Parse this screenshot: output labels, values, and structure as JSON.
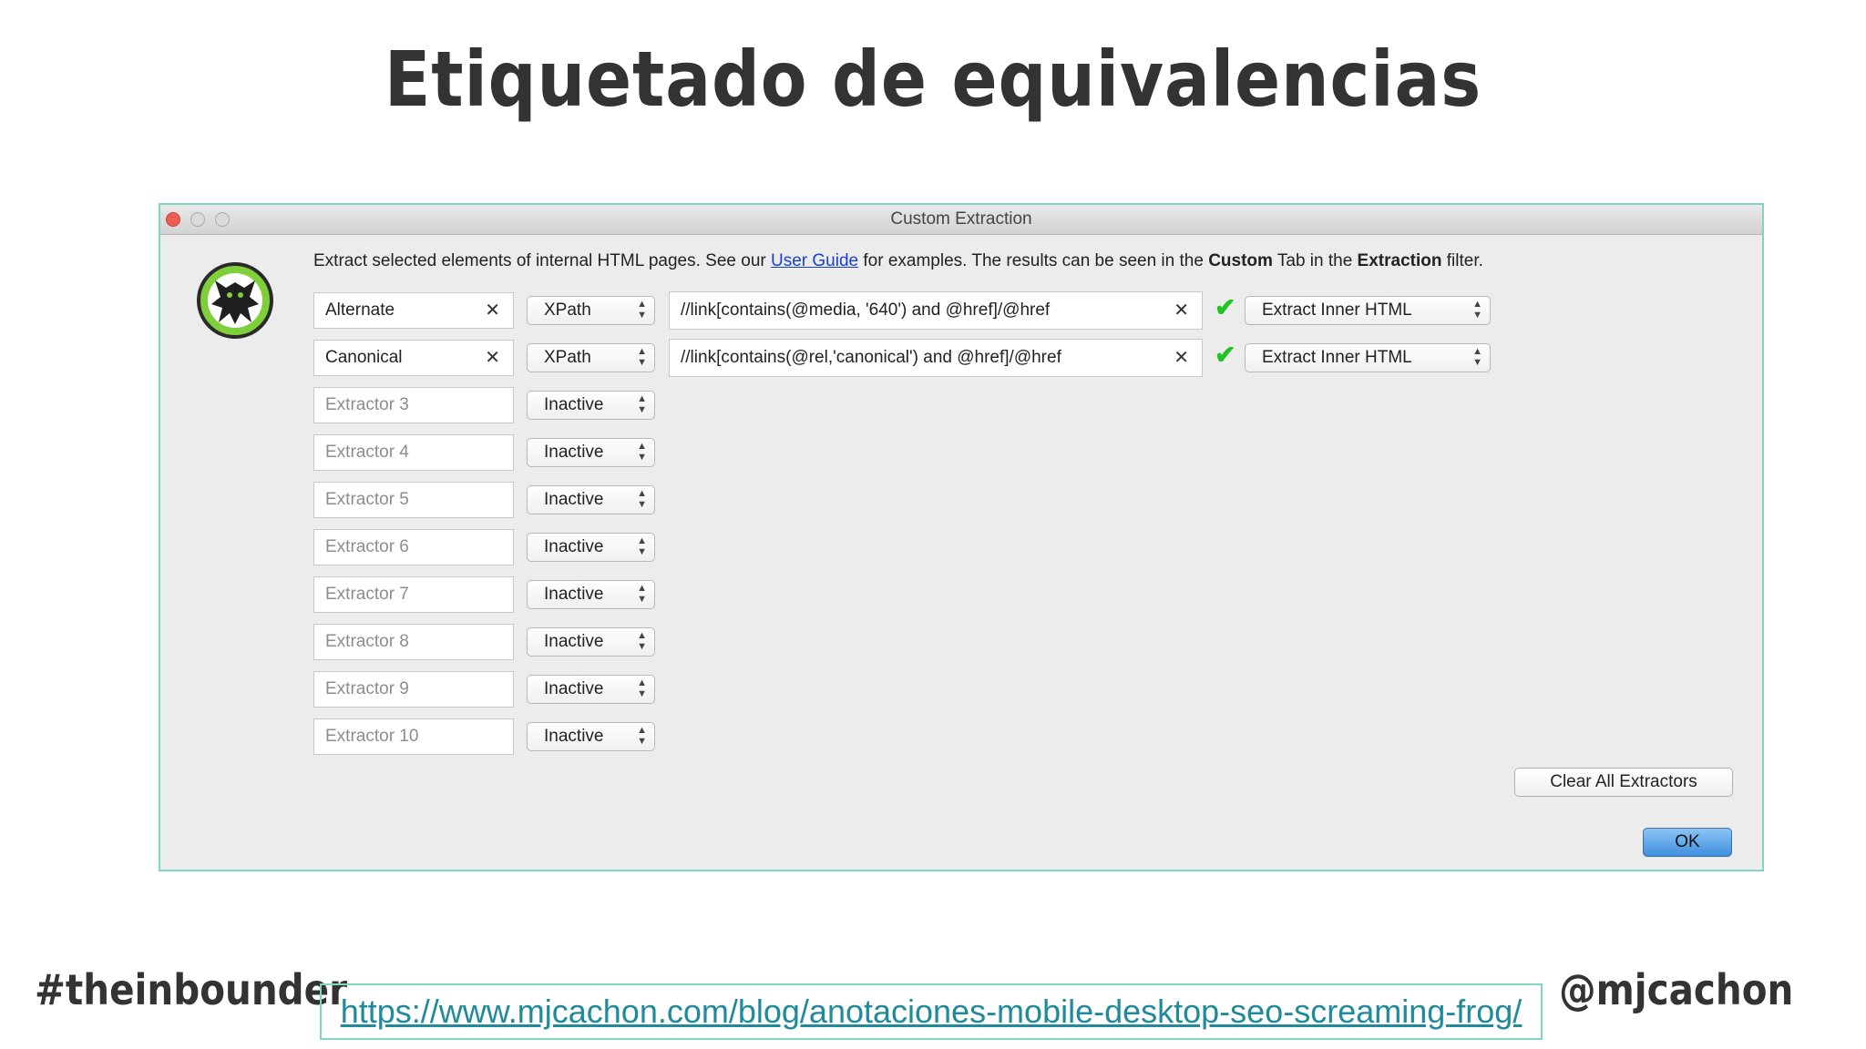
{
  "slide": {
    "title": "Etiquetado de equivalencias",
    "hashtag": "#theinbounder",
    "handle": "@mjcachon",
    "url": "https://www.mjcachon.com/blog/anotaciones-mobile-desktop-seo-screaming-frog/"
  },
  "window": {
    "title": "Custom Extraction",
    "intro": {
      "text1": "Extract selected elements of internal HTML pages. See our ",
      "link": "User Guide",
      "text2": " for examples. The results can be seen in the ",
      "bold1": "Custom",
      "text3": " Tab in the ",
      "bold2": "Extraction",
      "text4": " filter."
    },
    "extractors": [
      {
        "name": "Alternate",
        "type": "XPath",
        "expression": "//link[contains(@media, '640') and @href]/@href",
        "mode": "Extract Inner HTML"
      },
      {
        "name": "Canonical",
        "type": "XPath",
        "expression": "//link[contains(@rel,'canonical') and @href]/@href",
        "mode": "Extract Inner HTML"
      },
      {
        "name": "Extractor 3",
        "type": "Inactive"
      },
      {
        "name": "Extractor 4",
        "type": "Inactive"
      },
      {
        "name": "Extractor 5",
        "type": "Inactive"
      },
      {
        "name": "Extractor 6",
        "type": "Inactive"
      },
      {
        "name": "Extractor 7",
        "type": "Inactive"
      },
      {
        "name": "Extractor 8",
        "type": "Inactive"
      },
      {
        "name": "Extractor 9",
        "type": "Inactive"
      },
      {
        "name": "Extractor 10",
        "type": "Inactive"
      }
    ],
    "clear_all_label": "Clear All Extractors",
    "ok_label": "OK"
  },
  "icons": {
    "clear": "close-icon",
    "valid": "checkmark-icon",
    "select": "stepper-arrows-icon",
    "logo": "screaming-frog-logo"
  },
  "colors": {
    "accent_border": "#7fd6c2",
    "link": "#1a3fd4",
    "check": "#22c322",
    "url": "#1f8a99"
  }
}
